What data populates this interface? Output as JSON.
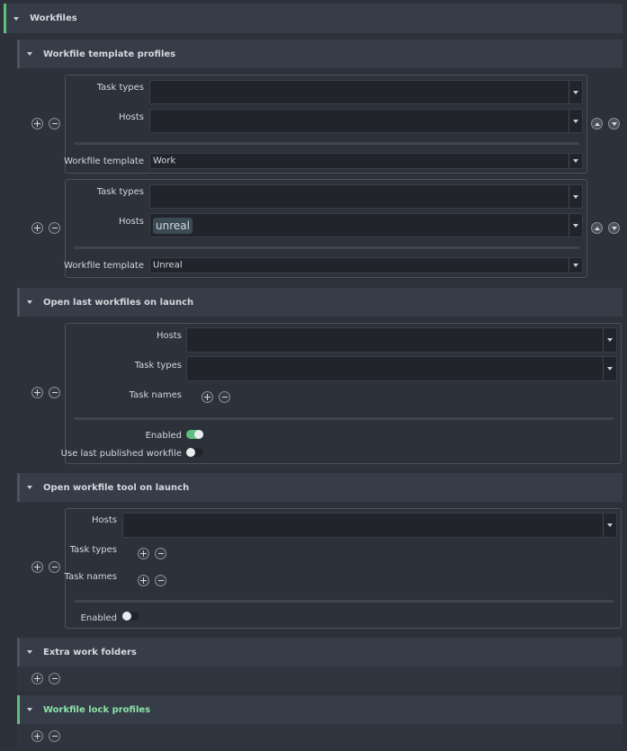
{
  "workfiles": {
    "title": "Workfiles",
    "template_profiles": {
      "title": "Workfile template profiles",
      "items": [
        {
          "task_types_label": "Task types",
          "task_types_value": "",
          "hosts_label": "Hosts",
          "hosts_value": "",
          "template_label": "Workfile template",
          "template_value": "Work"
        },
        {
          "task_types_label": "Task types",
          "task_types_value": "",
          "hosts_label": "Hosts",
          "hosts_chip": "unreal",
          "template_label": "Workfile template",
          "template_value": "Unreal"
        }
      ]
    },
    "open_last_workfile": {
      "title": "Open last workfiles on launch",
      "hosts_label": "Hosts",
      "task_types_label": "Task types",
      "task_names_label": "Task names",
      "enabled_label": "Enabled",
      "enabled": true,
      "use_last_published_label": "Use last published workfile",
      "use_last_published": false
    },
    "open_workfile_tool": {
      "title": "Open workfile tool on launch",
      "hosts_label": "Hosts",
      "task_types_label": "Task types",
      "task_names_label": "Task names",
      "enabled_label": "Enabled",
      "enabled": false
    },
    "extra_work_folders": {
      "title": "Extra work folders"
    },
    "workfile_lock_profiles": {
      "title": "Workfile lock profiles"
    }
  },
  "colors": {
    "background": "#2c313a",
    "header": "#373d48",
    "input": "#21252b",
    "accent_green": "#5fbe7e",
    "green_title": "#8be2a8"
  },
  "icons": {
    "add": "plus-circle-icon",
    "remove": "minus-circle-icon",
    "move_up": "chevron-up-icon",
    "move_down": "chevron-down-icon",
    "expand": "caret-down-icon",
    "dropdown": "dropdown-arrow-icon"
  }
}
